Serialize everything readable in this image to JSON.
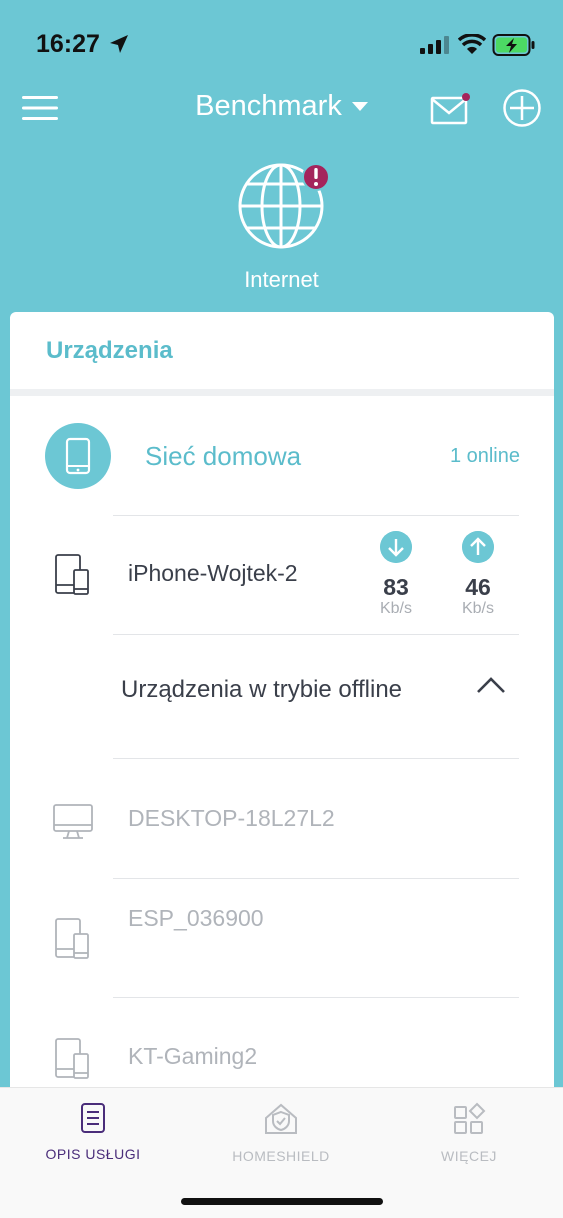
{
  "status_bar": {
    "time": "16:27"
  },
  "header": {
    "title": "Benchmark"
  },
  "internet": {
    "label": "Internet"
  },
  "card": {
    "title": "Urządzenia",
    "network": {
      "name": "Sieć domowa",
      "online": "1 online"
    },
    "online_devices": [
      {
        "name": "iPhone-Wojtek-2",
        "download": "83",
        "download_unit": "Kb/s",
        "upload": "46",
        "upload_unit": "Kb/s",
        "icon": "phone-tablet-icon"
      }
    ],
    "offline_section": {
      "title": "Urządzenia w trybie offline",
      "expanded": true
    },
    "offline_devices": [
      {
        "name": "DESKTOP-18L27L2",
        "icon": "desktop-icon"
      },
      {
        "name": "ESP_036900",
        "icon": "phone-tablet-icon"
      },
      {
        "name": "KT-Gaming2",
        "icon": "phone-tablet-icon"
      }
    ]
  },
  "tabbar": {
    "tabs": [
      {
        "label": "OPIS USŁUGI",
        "icon": "document-icon",
        "active": true
      },
      {
        "label": "HOMESHIELD",
        "icon": "shield-home-icon",
        "active": false
      },
      {
        "label": "WIĘCEJ",
        "icon": "grid-icon",
        "active": false
      }
    ]
  },
  "colors": {
    "primary": "#6cc7d4",
    "accent_dark": "#4a2d7a",
    "alert": "#a4245c"
  }
}
